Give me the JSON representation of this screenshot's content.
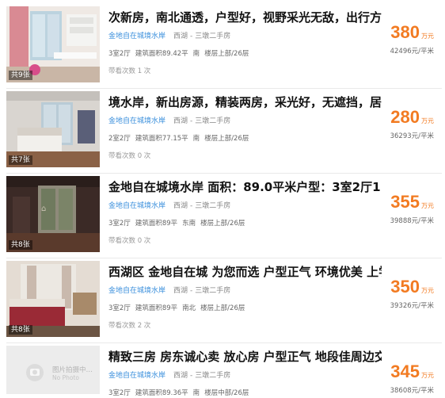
{
  "listings": [
    {
      "title": "次新房，南北通透，户型好，视野采光无敌，出行方便，诚心出售",
      "community": "金地自在城境水岸",
      "district": "西湖",
      "type": "三墩二手房",
      "layout": "3室2厅",
      "area": "建筑面积89.42平",
      "orientation": "南",
      "floor": "楼层上部/26层",
      "views": "带看次数 1 次",
      "price": "380",
      "price_unit": "万元",
      "unit_price": "42496元/平米",
      "photo_count": "共9张"
    },
    {
      "title": "境水岸，新出房源，精装两房，采光好，无遮挡，居住老少皆宜。",
      "community": "金地自在城境水岸",
      "district": "西湖",
      "type": "三墩二手房",
      "layout": "2室2厅",
      "area": "建筑面积77.15平",
      "orientation": "南",
      "floor": "楼层上部/26层",
      "views": "带看次数 0 次",
      "price": "280",
      "price_unit": "万元",
      "unit_price": "36293元/平米",
      "photo_count": "共7张"
    },
    {
      "title": "金地自在城境水岸 面积：89.0平米户型：3室2厅1",
      "community": "金地自在城境水岸",
      "district": "西湖",
      "type": "三墩二手房",
      "layout": "3室2厅",
      "area": "建筑面积89平",
      "orientation": "东南",
      "floor": "楼层上部/26层",
      "views": "带看次数 0 次",
      "price": "355",
      "price_unit": "万元",
      "unit_price": "39888元/平米",
      "photo_count": "共8张"
    },
    {
      "title": "西湖区 金地自在城 为您而选 户型正气 环境优美 上学方便",
      "community": "金地自在城境水岸",
      "district": "西湖",
      "type": "三墩二手房",
      "layout": "3室2厅",
      "area": "建筑面积89平",
      "orientation": "南北",
      "floor": "楼层上部/26层",
      "views": "带看次数 2 次",
      "price": "350",
      "price_unit": "万元",
      "unit_price": "39326元/平米",
      "photo_count": "共8张"
    },
    {
      "title": "精致三房 房东诚心卖 放心房 户型正气 地段佳周边交通便利",
      "community": "金地自在城境水岸",
      "district": "西湖",
      "type": "三墩二手房",
      "layout": "3室2厅",
      "area": "建筑面积89.36平",
      "orientation": "南",
      "floor": "楼层中部/26层",
      "views": "",
      "price": "345",
      "price_unit": "万元",
      "unit_price": "38608元/平米",
      "photo_count": "",
      "placeholder_text": "图片拍摄中…",
      "placeholder_sub": "No Photo"
    }
  ]
}
